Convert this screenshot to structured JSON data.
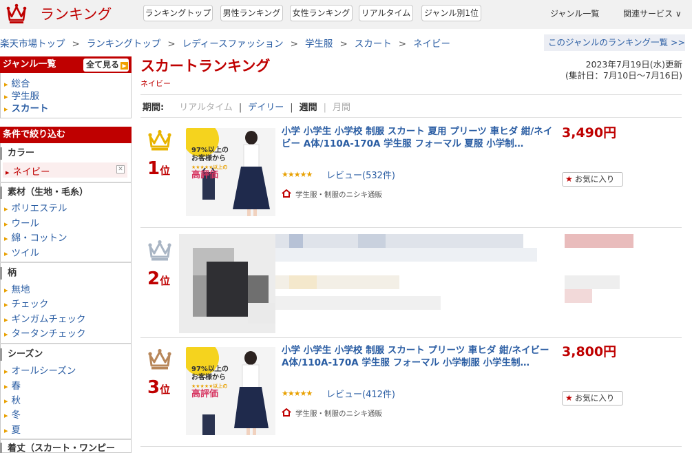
{
  "header": {
    "logo_text": "ランキング",
    "nav": [
      "ランキングトップ",
      "男性ランキング",
      "女性ランキング",
      "リアルタイム",
      "ジャンル別1位"
    ],
    "genre_list_link": "ジャンル一覧",
    "related_services": "関連サービス ∨"
  },
  "breadcrumb": [
    "楽天市場トップ",
    "ランキングトップ",
    "レディースファッション",
    "学生服",
    "スカート",
    "ネイビー"
  ],
  "breadcrumb_sep": ">",
  "genre_ranking_list_btn": "このジャンルのランキング一覧 >>",
  "sidebar": {
    "genre_head": "ジャンル一覧",
    "all_btn": "全て見る",
    "genres": [
      "総合",
      "学生服",
      "スカート"
    ],
    "filter_head": "条件で絞り込む",
    "color_title": "カラー",
    "selected_color": "ネイビー",
    "material_title": "素材（生地・毛糸）",
    "materials": [
      "ポリエステル",
      "ウール",
      "綿・コットン",
      "ツイル"
    ],
    "pattern_title": "柄",
    "patterns": [
      "無地",
      "チェック",
      "ギンガムチェック",
      "タータンチェック"
    ],
    "season_title": "シーズン",
    "seasons": [
      "オールシーズン",
      "春",
      "秋",
      "冬",
      "夏"
    ],
    "length_title": "着丈（スカート・ワンピー"
  },
  "main": {
    "title": "スカートランキング",
    "subtitle": "ネイビー",
    "updated_line1": "2023年7月19日(水)更新",
    "updated_line2": "(集計日：7月10日～7月16日)",
    "period_label": "期間:",
    "period_realtime": "リアルタイム",
    "period_daily": "デイリー",
    "period_weekly": "週間",
    "period_monthly": "月間",
    "period_sep": "|"
  },
  "items": [
    {
      "rank": "1",
      "rank_suffix": "位",
      "title": "小学 小学生 小学校 制服 スカート 夏用 プリーツ 車ヒダ 紺/ネイビー A体/110A-170A 学生服 フォーマル 夏服 小学制…",
      "stars": "★★★★★",
      "rating": 4.5,
      "review": "レビュー(532件)",
      "shop": "学生服・制服のニシキ通販",
      "price": "3,490円",
      "fav": "お気に入り",
      "img_badge_line1": "97%以上の",
      "img_badge_line2": "お客様から",
      "img_badge_line3": "以上の",
      "img_badge_line4": "高評価"
    },
    {
      "rank": "2",
      "rank_suffix": "位"
    },
    {
      "rank": "3",
      "rank_suffix": "位",
      "title": "小学 小学生 小学校 制服 スカート プリーツ 車ヒダ 紺/ネイビー A体/110A-170A 学生服 フォーマル 小学制服 小学生制…",
      "stars": "★★★★★",
      "rating": 4.5,
      "review": "レビュー(412件)",
      "shop": "学生服・制服のニシキ通販",
      "price": "3,800円",
      "fav": "お気に入り",
      "img_badge_line1": "97%以上の",
      "img_badge_line2": "お客様から",
      "img_badge_line3": "以上の",
      "img_badge_line4": "高評価"
    }
  ],
  "colors": {
    "brand_red": "#bf0000",
    "link_blue": "#2a5da3",
    "crown_gold": "#e8b400",
    "crown_silver": "#a9b5c4",
    "crown_bronze": "#b8875a"
  }
}
